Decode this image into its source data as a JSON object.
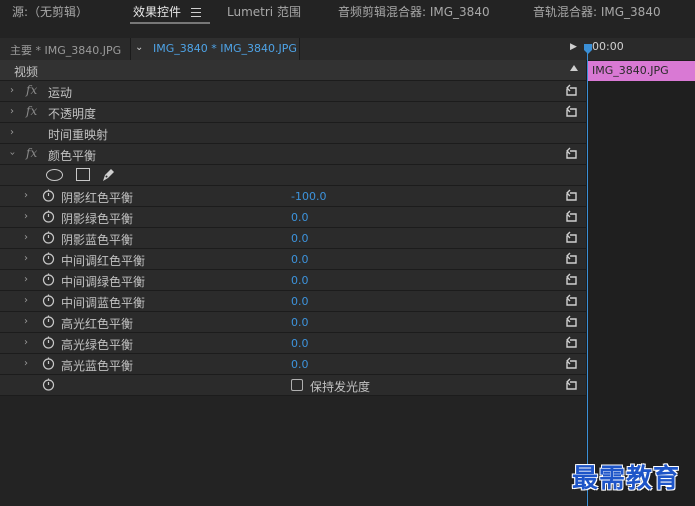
{
  "topbar": {
    "source_tab": "源:（无剪辑）",
    "effects_tab": "效果控件",
    "lumetri_tab": "Lumetri 范围",
    "audio_clip_mixer_tab": "音频剪辑混合器: IMG_3840",
    "audio_track_mixer_tab": "音轨混合器: IMG_3840"
  },
  "clipbar": {
    "master_label": "主要 * IMG_3840.JPG",
    "sequence_label": "IMG_3840 * IMG_3840.JPG",
    "timecode": "00:00"
  },
  "timeline": {
    "clip_name": "IMG_3840.JPG",
    "clip_color": "#d979d4",
    "playhead_color": "#3a8fd6"
  },
  "effects": {
    "section_header": "视频",
    "motion": "运动",
    "opacity": "不透明度",
    "time_remap": "时间重映射",
    "color_balance": "颜色平衡",
    "params": [
      {
        "label": "阴影红色平衡",
        "value": "-100.0"
      },
      {
        "label": "阴影绿色平衡",
        "value": "0.0"
      },
      {
        "label": "阴影蓝色平衡",
        "value": "0.0"
      },
      {
        "label": "中间调红色平衡",
        "value": "0.0"
      },
      {
        "label": "中间调绿色平衡",
        "value": "0.0"
      },
      {
        "label": "中间调蓝色平衡",
        "value": "0.0"
      },
      {
        "label": "高光红色平衡",
        "value": "0.0"
      },
      {
        "label": "高光绿色平衡",
        "value": "0.0"
      },
      {
        "label": "高光蓝色平衡",
        "value": "0.0"
      }
    ],
    "preserve_luminosity": "保持发光度",
    "fx_glyph": "fx",
    "value_color": "#3d93dc"
  },
  "watermark": "最需教育"
}
